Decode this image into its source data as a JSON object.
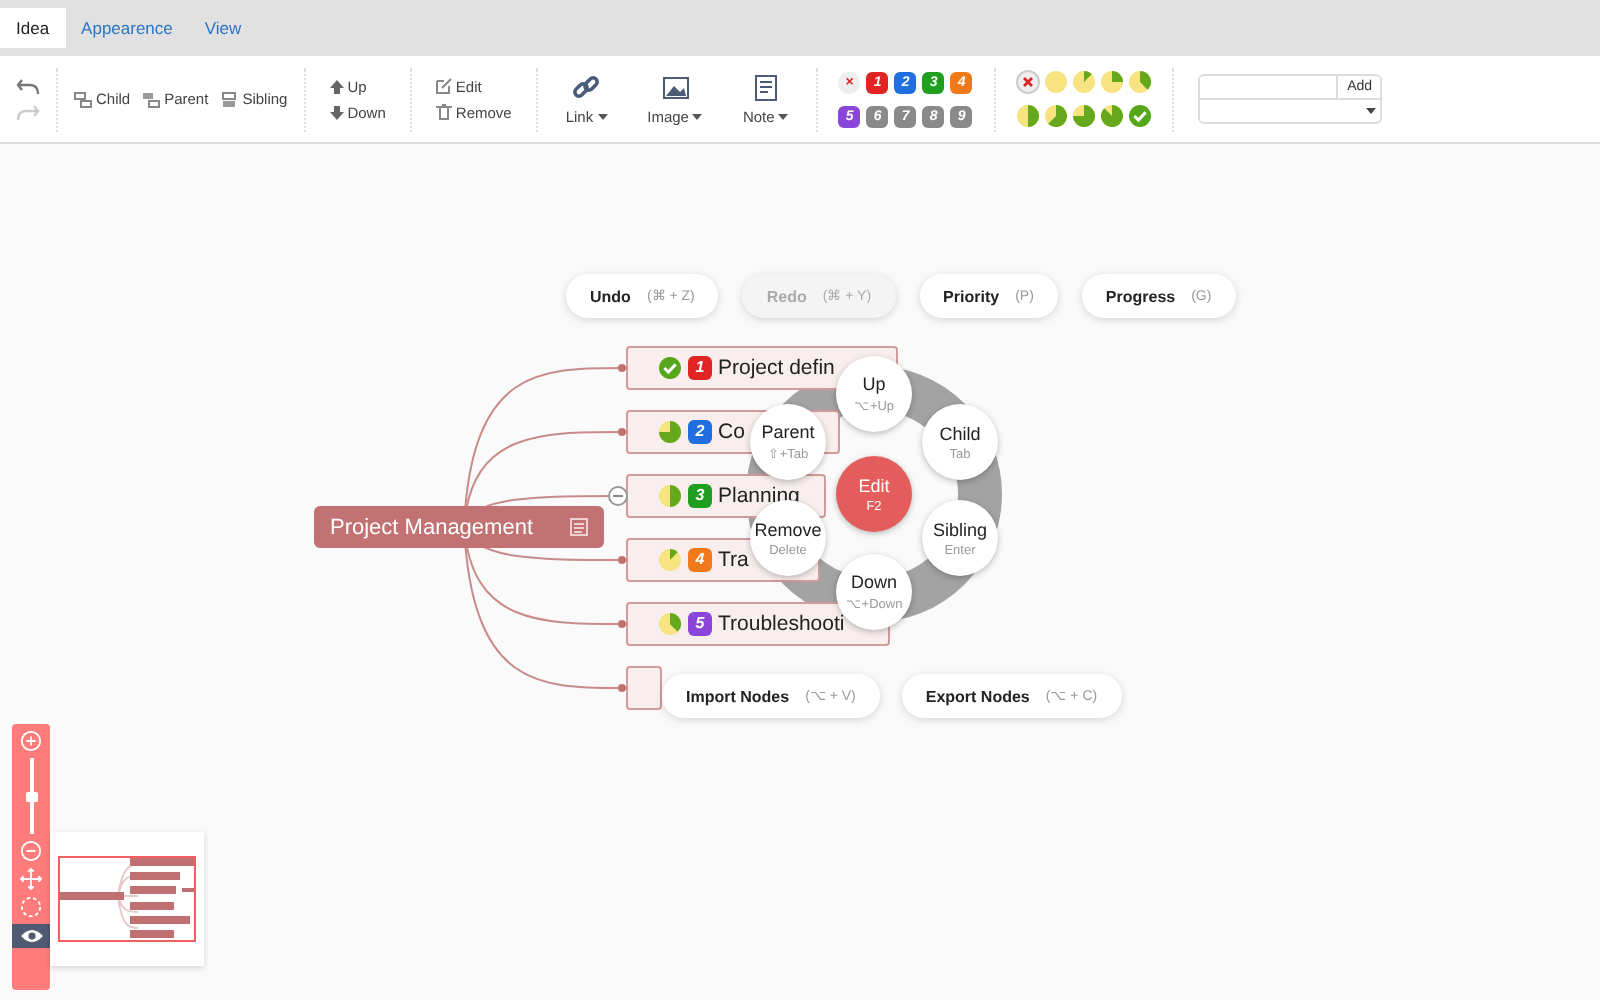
{
  "tabs": [
    {
      "label": "Idea",
      "selected": true
    },
    {
      "label": "Appearence",
      "selected": false
    },
    {
      "label": "View",
      "selected": false
    }
  ],
  "toolbar": {
    "undo": {
      "disabled": false
    },
    "redo": {
      "disabled": true
    },
    "insert": [
      {
        "kind": "child",
        "label": "Child"
      },
      {
        "kind": "parent",
        "label": "Parent"
      },
      {
        "kind": "sibling",
        "label": "Sibling"
      }
    ],
    "move": [
      {
        "kind": "up",
        "label": "Up"
      },
      {
        "kind": "down",
        "label": "Down"
      }
    ],
    "edit": [
      {
        "kind": "edit",
        "label": "Edit"
      },
      {
        "kind": "remove",
        "label": "Remove"
      }
    ],
    "media": [
      {
        "kind": "link",
        "label": "Link"
      },
      {
        "kind": "image",
        "label": "Image"
      },
      {
        "kind": "note",
        "label": "Note"
      }
    ],
    "priorities": [
      {
        "kind": "clear",
        "label": "×"
      },
      {
        "kind": "number",
        "label": "1",
        "color": "#e02424"
      },
      {
        "kind": "number",
        "label": "2",
        "color": "#1f6fe0"
      },
      {
        "kind": "number",
        "label": "3",
        "color": "#1f9e1f"
      },
      {
        "kind": "number",
        "label": "4",
        "color": "#f07a1a"
      },
      {
        "kind": "number",
        "label": "5",
        "color": "#8a46d8"
      },
      {
        "kind": "number",
        "label": "6",
        "color": "#8a8a8a"
      },
      {
        "kind": "number",
        "label": "7",
        "color": "#8a8a8a"
      },
      {
        "kind": "number",
        "label": "8",
        "color": "#8a8a8a"
      },
      {
        "kind": "number",
        "label": "9",
        "color": "#8a8a8a"
      }
    ],
    "progress": [
      {
        "kind": "clear"
      },
      {
        "kind": "empty"
      },
      {
        "kind": "eighth"
      },
      {
        "kind": "quarter"
      },
      {
        "kind": "three-eighths"
      },
      {
        "kind": "half"
      },
      {
        "kind": "five-eighths"
      },
      {
        "kind": "three-quarters"
      },
      {
        "kind": "seven-eighths"
      },
      {
        "kind": "done"
      }
    ],
    "resource": {
      "button": "Add"
    }
  },
  "quick_actions": [
    {
      "label": "Undo",
      "shortcut": "(⌘ + Z)",
      "disabled": false
    },
    {
      "label": "Redo",
      "shortcut": "(⌘ + Y)",
      "disabled": true
    },
    {
      "label": "Priority",
      "shortcut": "(P)",
      "disabled": false
    },
    {
      "label": "Progress",
      "shortcut": "(G)",
      "disabled": false
    }
  ],
  "root": {
    "text": "Project Management"
  },
  "nodes": [
    {
      "text": "Project defin",
      "priority": "1",
      "color": "#e02424",
      "kind": "done",
      "collapsible": false
    },
    {
      "text": "Co",
      "priority": "2",
      "color": "#1f6fe0",
      "kind": "three-quarters",
      "collapsible": false
    },
    {
      "text": "Planning",
      "priority": "3",
      "color": "#1f9e1f",
      "kind": "half",
      "collapsible": true
    },
    {
      "text": "Tra",
      "priority": "4",
      "color": "#f07a1a",
      "kind": "eighth",
      "collapsible": false
    },
    {
      "text": "Troubleshooti",
      "priority": "5",
      "color": "#8a46d8",
      "kind": "three-eighths",
      "collapsible": false
    }
  ],
  "radial_menu": {
    "center": {
      "label": "Edit",
      "shortcut": "F2"
    },
    "items": [
      {
        "label": "Up",
        "shortcut": "⌥+Up"
      },
      {
        "label": "Parent",
        "shortcut": "⇧+Tab"
      },
      {
        "label": "Child",
        "shortcut": "Tab"
      },
      {
        "label": "Remove",
        "shortcut": "Delete"
      },
      {
        "label": "Sibling",
        "shortcut": "Enter"
      },
      {
        "label": "Down",
        "shortcut": "⌥+Down"
      }
    ]
  },
  "clipboard_actions": [
    {
      "label": "Import Nodes",
      "shortcut": "(⌥ + V)"
    },
    {
      "label": "Export Nodes",
      "shortcut": "(⌥ + C)"
    }
  ],
  "zoom": {
    "level": 0.5,
    "navigator_on": true
  }
}
